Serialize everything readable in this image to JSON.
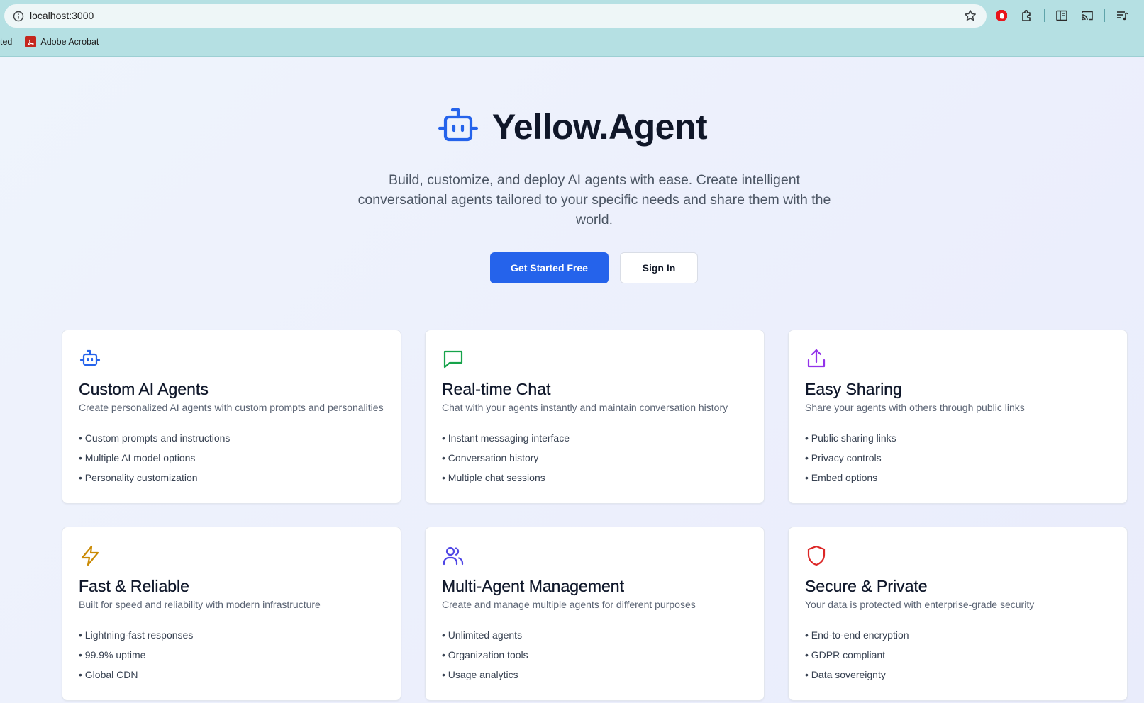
{
  "browser": {
    "url": "localhost:3000",
    "bookmarks": {
      "truncated": "ted",
      "items": [
        {
          "label": "Adobe Acrobat",
          "icon": "adobe-acrobat-icon"
        }
      ]
    }
  },
  "hero": {
    "brand": "Yellow.Agent",
    "description": "Build, customize, and deploy AI agents with ease. Create intelligent conversational agents tailored to your specific needs and share them with the world.",
    "primary_cta": "Get Started Free",
    "secondary_cta": "Sign In"
  },
  "features": [
    {
      "title": "Custom AI Agents",
      "description": "Create personalized AI agents with custom prompts and personalities",
      "icon": "bot-icon",
      "color": "#2563eb",
      "bullets": [
        "• Custom prompts and instructions",
        "• Multiple AI model options",
        "• Personality customization"
      ]
    },
    {
      "title": "Real-time Chat",
      "description": "Chat with your agents instantly and maintain conversation history",
      "icon": "chat-icon",
      "color": "#16a34a",
      "bullets": [
        "• Instant messaging interface",
        "• Conversation history",
        "• Multiple chat sessions"
      ]
    },
    {
      "title": "Easy Sharing",
      "description": "Share your agents with others through public links",
      "icon": "share-icon",
      "color": "#9333ea",
      "bullets": [
        "• Public sharing links",
        "• Privacy controls",
        "• Embed options"
      ]
    },
    {
      "title": "Fast & Reliable",
      "description": "Built for speed and reliability with modern infrastructure",
      "icon": "lightning-icon",
      "color": "#ca8a04",
      "bullets": [
        "• Lightning-fast responses",
        "• 99.9% uptime",
        "• Global CDN"
      ]
    },
    {
      "title": "Multi-Agent Management",
      "description": "Create and manage multiple agents for different purposes",
      "icon": "users-icon",
      "color": "#4f46e5",
      "bullets": [
        "• Unlimited agents",
        "• Organization tools",
        "• Usage analytics"
      ]
    },
    {
      "title": "Secure & Private",
      "description": "Your data is protected with enterprise-grade security",
      "icon": "shield-icon",
      "color": "#dc2626",
      "bullets": [
        "• End-to-end encryption",
        "• GDPR compliant",
        "• Data sovereignty"
      ]
    }
  ]
}
